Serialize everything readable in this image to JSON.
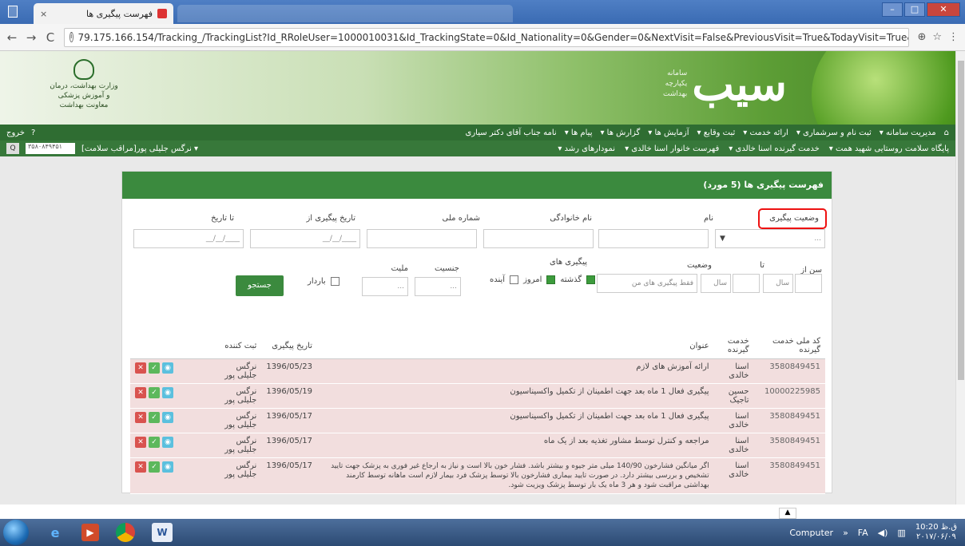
{
  "browser": {
    "tab_title": "فهرست پیگیری ها",
    "tab_close": "×",
    "url": "79.175.166.154/Tracking_/TrackingList?Id_RRoleUser=1000010031&Id_TrackingState=0&Id_Nationality=0&Gender=0&NextVisit=False&PreviousVisit=True&TodayVisit=True&State...",
    "back": "←",
    "forward": "→",
    "reload": "C",
    "info": "i",
    "zoom": "⊕",
    "star": "☆",
    "menu": "⋮"
  },
  "banner": {
    "ministry_lines": [
      "وزارت بهداشت، درمان و آموزش پزشکی",
      "معاونت بهداشت"
    ],
    "brand": "سیب",
    "brand_sub": [
      "سامانه",
      "یکپارچه",
      "بهداشت"
    ]
  },
  "mainnav": {
    "items": [
      "مدیریت سامانه ▾",
      "ثبت نام و سرشماری ▾",
      "ارائه خدمت ▾",
      "ثبت وقایع ▾",
      "آزمایش ها ▾",
      "گزارش ها ▾",
      "پیام ها ▾",
      "نامه جناب آقای دکتر سیاری"
    ],
    "exit": "خروج",
    "help": "?"
  },
  "subnav": {
    "items": [
      "پایگاه سلامت روستایی شهید همت ▾",
      "خدمت گیرنده اسنا خالدی ▾",
      "فهرست خانوار اسنا خالدی ▾",
      "نمودارهای رشد ▾"
    ],
    "user": "نرگس جلیلی پور[مراقب سلامت] ▾",
    "code": "۳۵۸۰۸۴۹۴۵۱",
    "search_icon": "Q"
  },
  "panel": {
    "title": "فهرست پیگیری ها (5 مورد)",
    "labels": {
      "state": "وضعیت پیگیری",
      "first_name": "نام",
      "last_name": "نام خانوادگی",
      "national_id": "شماره ملی",
      "date_from": "تاریخ پیگیری از",
      "date_to": "تا تاریخ",
      "age_from": "سن از",
      "age_to": "تا",
      "status": "وضعیت",
      "followups": "پیگیری های",
      "gender": "جنسیت",
      "nationality": "ملیت",
      "pregnant": "باردار"
    },
    "placeholders": {
      "state": "...",
      "date_from": "__/__/____",
      "date_to": "__/__/____",
      "age_unit": "سال",
      "status": "فقط پیگیری های من",
      "gender": "...",
      "nationality": "..."
    },
    "followup_options": [
      "گذشته",
      "امروز",
      "آینده"
    ],
    "search_button": "جستجو"
  },
  "table": {
    "headers": [
      "کد ملی خدمت گیرنده",
      "خدمت گیرنده",
      "عنوان",
      "تاریخ پیگیری",
      "ثبت کننده",
      ""
    ],
    "rows": [
      {
        "id": "3580849451",
        "client": "اسنا خالدی",
        "title": "ارائه آموزش های لازم",
        "date": "1396/05/23",
        "by": "نرگس جلیلی پور"
      },
      {
        "id": "10000225985",
        "client": "حسین تاجیک",
        "title": "پیگیری فعال 1 ماه بعد جهت اطمینان از تکمیل واکسیناسیون",
        "date": "1396/05/19",
        "by": "نرگس جلیلی پور"
      },
      {
        "id": "3580849451",
        "client": "اسنا خالدی",
        "title": "پیگیری فعال 1 ماه بعد جهت اطمینان از تکمیل واکسیناسیون",
        "date": "1396/05/17",
        "by": "نرگس جلیلی پور"
      },
      {
        "id": "3580849451",
        "client": "اسنا خالدی",
        "title": "مراجعه و کنترل توسط مشاور تغذیه بعد از یک ماه",
        "date": "1396/05/17",
        "by": "نرگس جلیلی پور"
      },
      {
        "id": "3580849451",
        "client": "اسنا خالدی",
        "title": "اگر میانگین فشارخون 140/90 میلی متر جیوه و بیشتر باشد. فشار خون بالا است و نیاز به ارجاع غیر فوری به پزشک جهت تایید تشخیص و بررسی بیشتر دارد. در صورت تایید بیماری فشارخون بالا توسط پزشک فرد بیمار لازم است ماهانه توسط کارمند بهداشتی مراقبت شود و هر 3 ماه یک بار توسط پزشک ویزیت شود.",
        "date": "1396/05/17",
        "by": "نرگس جلیلی پور"
      }
    ],
    "action_icons": {
      "view": "◉",
      "ok": "✓",
      "del": "✕"
    }
  },
  "taskbar": {
    "computer": "Computer",
    "lang": "FA",
    "time": "10:20 ق.ظ",
    "date": "۲۰۱۷/۰۶/۰۹",
    "chevron": "»"
  },
  "colors": {
    "accent": "#3b8a3e",
    "row": "#f2dede",
    "highlight": "#e11111"
  }
}
